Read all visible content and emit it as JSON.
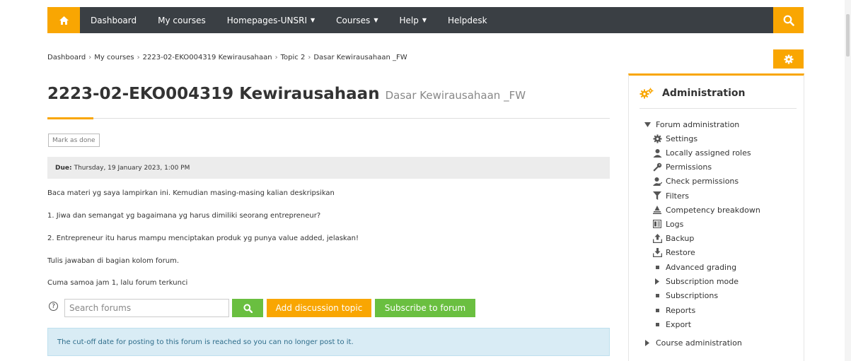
{
  "nav": {
    "items": [
      {
        "label": "Dashboard",
        "caret": ""
      },
      {
        "label": "My courses",
        "caret": ""
      },
      {
        "label": "Homepages-UNSRI",
        "caret": "▼"
      },
      {
        "label": "Courses",
        "caret": "▼"
      },
      {
        "label": "Help",
        "caret": "▼"
      },
      {
        "label": "Helpdesk",
        "caret": ""
      }
    ]
  },
  "breadcrumb": {
    "items": [
      "Dashboard",
      "My courses",
      "2223-02-EKO004319 Kewirausahaan",
      "Topic 2",
      "Dasar Kewirausahaan _FW"
    ],
    "sep": "›"
  },
  "heading": {
    "course": "2223-02-EKO004319 Kewirausahaan",
    "activity": "Dasar Kewirausahaan _FW"
  },
  "mark_done": "Mark as done",
  "due": {
    "label": "Due:",
    "value": "Thursday, 19 January 2023, 1:00 PM"
  },
  "description": [
    "Baca materi yg saya lampirkan ini. Kemudian masing-masing kalian deskripsikan",
    "1. Jiwa dan semangat  yg bagaimana  yg harus dimiliki seorang entrepreneur?",
    "2. Entrepreneur itu harus mampu menciptakan produk yg punya value added, jelaskan!",
    "Tulis jawaban di bagian kolom forum.",
    "Cuma samoa jam 1, lalu forum terkunci"
  ],
  "search": {
    "placeholder": "Search forums",
    "help": "?"
  },
  "buttons": {
    "add_topic": "Add discussion topic",
    "subscribe": "Subscribe to forum"
  },
  "alert": "The cut-off date for posting to this forum is reached so you can no longer post to it.",
  "admin": {
    "title": "Administration",
    "forum_admin": "Forum administration",
    "items": [
      {
        "label": "Settings",
        "icon": "gear-icon"
      },
      {
        "label": "Locally assigned roles",
        "icon": "user-icon"
      },
      {
        "label": "Permissions",
        "icon": "key-icon"
      },
      {
        "label": "Check permissions",
        "icon": "user-check-icon"
      },
      {
        "label": "Filters",
        "icon": "filter-icon"
      },
      {
        "label": "Competency breakdown",
        "icon": "competency-icon"
      },
      {
        "label": "Logs",
        "icon": "logs-icon"
      },
      {
        "label": "Backup",
        "icon": "upload-icon"
      },
      {
        "label": "Restore",
        "icon": "download-icon"
      },
      {
        "label": "Advanced grading",
        "icon": "bullet-icon"
      },
      {
        "label": "Subscription mode",
        "icon": "triangle-right-icon"
      },
      {
        "label": "Subscriptions",
        "icon": "bullet-icon"
      },
      {
        "label": "Reports",
        "icon": "bullet-icon"
      },
      {
        "label": "Export",
        "icon": "bullet-icon"
      }
    ],
    "course_admin": "Course administration"
  },
  "colors": {
    "accent": "#f9a602",
    "navbar": "#3a3f44",
    "green": "#6abf40",
    "alert_bg": "#d9ecf5"
  }
}
